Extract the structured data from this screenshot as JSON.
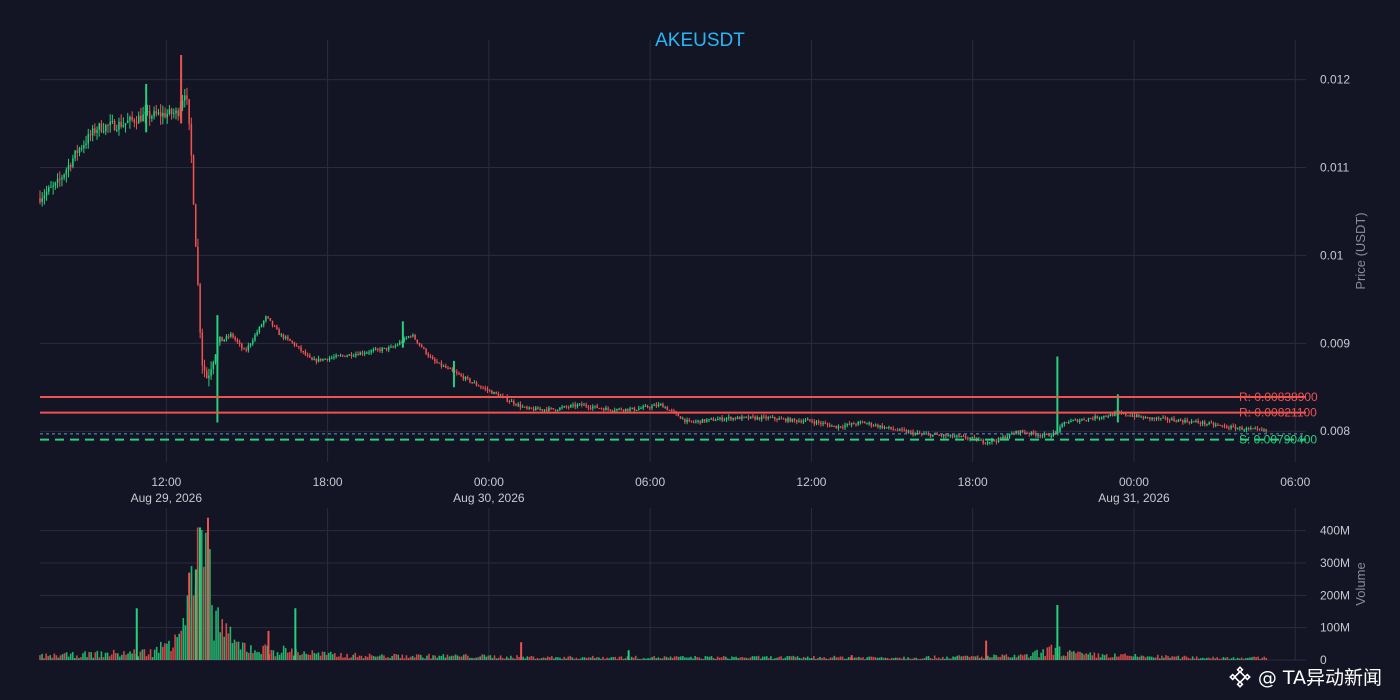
{
  "chart_data": {
    "type": "candlestick",
    "title": "AKEUSDT",
    "price_axis": {
      "label": "Price (USDT)",
      "range": [
        0.00765,
        0.01245
      ],
      "ticks": [
        {
          "value": 0.008,
          "label": "0.008"
        },
        {
          "value": 0.009,
          "label": "0.009"
        },
        {
          "value": 0.01,
          "label": "0.01"
        },
        {
          "value": 0.011,
          "label": "0.011"
        },
        {
          "value": 0.012,
          "label": "0.012"
        }
      ]
    },
    "volume_axis": {
      "label": "Volume",
      "range": [
        0,
        470
      ],
      "ticks": [
        {
          "value": 0,
          "label": "0"
        },
        {
          "value": 100,
          "label": "100M"
        },
        {
          "value": 200,
          "label": "200M"
        },
        {
          "value": 300,
          "label": "300M"
        },
        {
          "value": 400,
          "label": "400M"
        }
      ]
    },
    "time_axis": {
      "range_hours": [
        7.3,
        54.4
      ],
      "ticks": [
        {
          "hour": 12,
          "label": "12:00",
          "date": "Aug 29, 2026"
        },
        {
          "hour": 18,
          "label": "18:00",
          "date": ""
        },
        {
          "hour": 24,
          "label": "00:00",
          "date": "Aug 30, 2026"
        },
        {
          "hour": 30,
          "label": "06:00",
          "date": ""
        },
        {
          "hour": 36,
          "label": "12:00",
          "date": ""
        },
        {
          "hour": 42,
          "label": "18:00",
          "date": ""
        },
        {
          "hour": 48,
          "label": "00:00",
          "date": "Aug 31, 2026"
        },
        {
          "hour": 54,
          "label": "06:00",
          "date": ""
        }
      ]
    },
    "levels": [
      {
        "type": "resistance",
        "value": 0.008389,
        "label": "R: 0.00838900",
        "color": "#ef5350"
      },
      {
        "type": "resistance",
        "value": 0.008211,
        "label": "R: 0.00821100",
        "color": "#ef5350"
      },
      {
        "type": "support",
        "value": 0.007904,
        "label": "S: 0.00790400",
        "color": "#26d07c"
      },
      {
        "type": "current",
        "value": 0.00797,
        "label": "",
        "color": "#5b9bd5"
      }
    ],
    "price_path": [
      [
        7.3,
        0.01065
      ],
      [
        8.0,
        0.0108
      ],
      [
        8.8,
        0.0112
      ],
      [
        9.5,
        0.01145
      ],
      [
        10.5,
        0.0115
      ],
      [
        11.2,
        0.01158
      ],
      [
        11.8,
        0.0116
      ],
      [
        12.5,
        0.01162
      ],
      [
        12.8,
        0.0119
      ],
      [
        13.0,
        0.0112
      ],
      [
        13.2,
        0.01
      ],
      [
        13.4,
        0.0088
      ],
      [
        13.6,
        0.0086
      ],
      [
        14.0,
        0.009
      ],
      [
        14.5,
        0.0091
      ],
      [
        15.0,
        0.0089
      ],
      [
        15.8,
        0.0093
      ],
      [
        16.3,
        0.0091
      ],
      [
        16.8,
        0.009
      ],
      [
        17.5,
        0.0088
      ],
      [
        18.5,
        0.00885
      ],
      [
        19.5,
        0.0089
      ],
      [
        20.5,
        0.00895
      ],
      [
        21.2,
        0.0091
      ],
      [
        22.0,
        0.0088
      ],
      [
        22.6,
        0.0087
      ],
      [
        23.2,
        0.0086
      ],
      [
        23.8,
        0.0085
      ],
      [
        24.5,
        0.0084
      ],
      [
        25.5,
        0.00825
      ],
      [
        26.5,
        0.00825
      ],
      [
        27.5,
        0.0083
      ],
      [
        28.5,
        0.00825
      ],
      [
        29.5,
        0.00825
      ],
      [
        30.5,
        0.0083
      ],
      [
        31.5,
        0.0081
      ],
      [
        33.0,
        0.00815
      ],
      [
        34.5,
        0.00815
      ],
      [
        35.5,
        0.00812
      ],
      [
        36.0,
        0.00812
      ],
      [
        37.0,
        0.00805
      ],
      [
        38.0,
        0.0081
      ],
      [
        39.0,
        0.00803
      ],
      [
        40.0,
        0.00797
      ],
      [
        41.0,
        0.00795
      ],
      [
        42.0,
        0.00792
      ],
      [
        42.5,
        0.00788
      ],
      [
        43.0,
        0.0079
      ],
      [
        43.8,
        0.008
      ],
      [
        44.8,
        0.00795
      ],
      [
        45.2,
        0.00798
      ],
      [
        45.5,
        0.0081
      ],
      [
        46.5,
        0.00815
      ],
      [
        47.5,
        0.0082
      ],
      [
        48.0,
        0.00818
      ],
      [
        48.5,
        0.00815
      ],
      [
        49.5,
        0.00813
      ],
      [
        50.5,
        0.0081
      ],
      [
        51.5,
        0.00805
      ],
      [
        53.0,
        0.008
      ]
    ],
    "last_time": 53.0,
    "spikes": [
      {
        "time": 12.55,
        "high": 0.01228,
        "low": 0.0115
      },
      {
        "time": 11.25,
        "high": 0.01195,
        "low": 0.0114
      },
      {
        "time": 13.9,
        "high": 0.00932,
        "low": 0.0081
      },
      {
        "time": 45.15,
        "high": 0.00885,
        "low": 0.00797
      },
      {
        "time": 22.7,
        "high": 0.0088,
        "low": 0.0085
      },
      {
        "time": 47.4,
        "high": 0.00842,
        "low": 0.0081
      },
      {
        "time": 20.8,
        "high": 0.00925,
        "low": 0.00895
      }
    ],
    "volume_profile": [
      [
        7.3,
        15
      ],
      [
        11.5,
        30
      ],
      [
        12.0,
        60
      ],
      [
        12.8,
        200
      ],
      [
        13.1,
        320
      ],
      [
        13.4,
        380
      ],
      [
        13.8,
        180
      ],
      [
        14.5,
        60
      ],
      [
        15.5,
        40
      ],
      [
        16.5,
        35
      ],
      [
        18.0,
        20
      ],
      [
        20.0,
        15
      ],
      [
        23.0,
        15
      ],
      [
        26.0,
        10
      ],
      [
        30.0,
        10
      ],
      [
        36.0,
        10
      ],
      [
        40.0,
        10
      ],
      [
        44.0,
        15
      ],
      [
        45.0,
        40
      ],
      [
        46.0,
        20
      ],
      [
        50.0,
        10
      ],
      [
        53.0,
        8
      ]
    ],
    "volume_spikes": [
      {
        "time": 13.25,
        "value": 410
      },
      {
        "time": 13.55,
        "value": 440
      },
      {
        "time": 13.1,
        "value": 280
      },
      {
        "time": 12.85,
        "value": 270
      },
      {
        "time": 10.9,
        "value": 160
      },
      {
        "time": 15.8,
        "value": 90
      },
      {
        "time": 16.8,
        "value": 160
      },
      {
        "time": 25.2,
        "value": 55
      },
      {
        "time": 29.2,
        "value": 30
      },
      {
        "time": 42.5,
        "value": 60
      },
      {
        "time": 45.15,
        "value": 170
      },
      {
        "time": 37.5,
        "value": 15
      }
    ],
    "colors": {
      "background": "#131424",
      "grid": "#2a2c3e",
      "up": "#26d07c",
      "down": "#ef5350",
      "title": "#29b6f6",
      "axis_text": "#c8c8d0"
    }
  },
  "watermark": {
    "text": "@ TA异动新闻",
    "logo_icon": "binance-square-logo"
  }
}
